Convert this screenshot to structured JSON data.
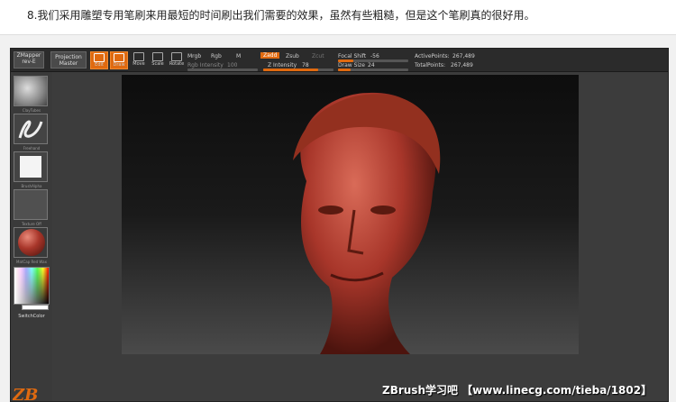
{
  "caption": "8.我们采用雕塑专用笔刷来用最短的时间刷出我们需要的效果，虽然有些粗糙，但是这个笔刷真的很好用。",
  "topbar": {
    "zmapper": "ZMapper",
    "zmapper_sub": "rev-E",
    "projection_master": "Projection Master",
    "tools": [
      {
        "label": "Edit",
        "icon": "edit-icon",
        "active": true
      },
      {
        "label": "Draw",
        "icon": "draw-icon",
        "active": true
      },
      {
        "label": "Move",
        "icon": "move-icon",
        "active": false
      },
      {
        "label": "Scale",
        "icon": "scale-icon",
        "active": false
      },
      {
        "label": "Rotate",
        "icon": "rotate-icon",
        "active": false
      }
    ],
    "mrgb": "Mrgb",
    "rgb": "Rgb",
    "m": "M",
    "rgb_intensity_label": "Rgb Intensity",
    "rgb_intensity_value": "100",
    "zadd": "Zadd",
    "zsub": "Zsub",
    "zcut": "Zcut",
    "z_intensity_label": "Z Intensity",
    "z_intensity_value": "78",
    "focal_shift_label": "Focal Shift",
    "focal_shift_value": "-56",
    "draw_size_label": "Draw Size",
    "draw_size_value": "24",
    "active_points_label": "ActivePoints:",
    "active_points_value": "267,489",
    "total_points_label": "TotalPoints:",
    "total_points_value": "267,489"
  },
  "sidebar": {
    "items": [
      {
        "label": "ClayTubes",
        "icon": "clay-brush-icon"
      },
      {
        "label": "Freehand",
        "icon": "freehand-stroke-icon"
      },
      {
        "label": "BrushAlpha",
        "icon": "alpha-icon"
      },
      {
        "label": "Texture Off",
        "icon": "texture-icon"
      },
      {
        "label": "MatCap Red Wax",
        "icon": "material-sphere-icon"
      }
    ],
    "switch_color": "SwitchColor"
  },
  "colors": {
    "accent": "#e06a10",
    "clay": "#a8362a",
    "app_bg": "#3c3c3c"
  },
  "watermark": "ZBrush学习吧 【www.linecg.com/tieba/1802】"
}
